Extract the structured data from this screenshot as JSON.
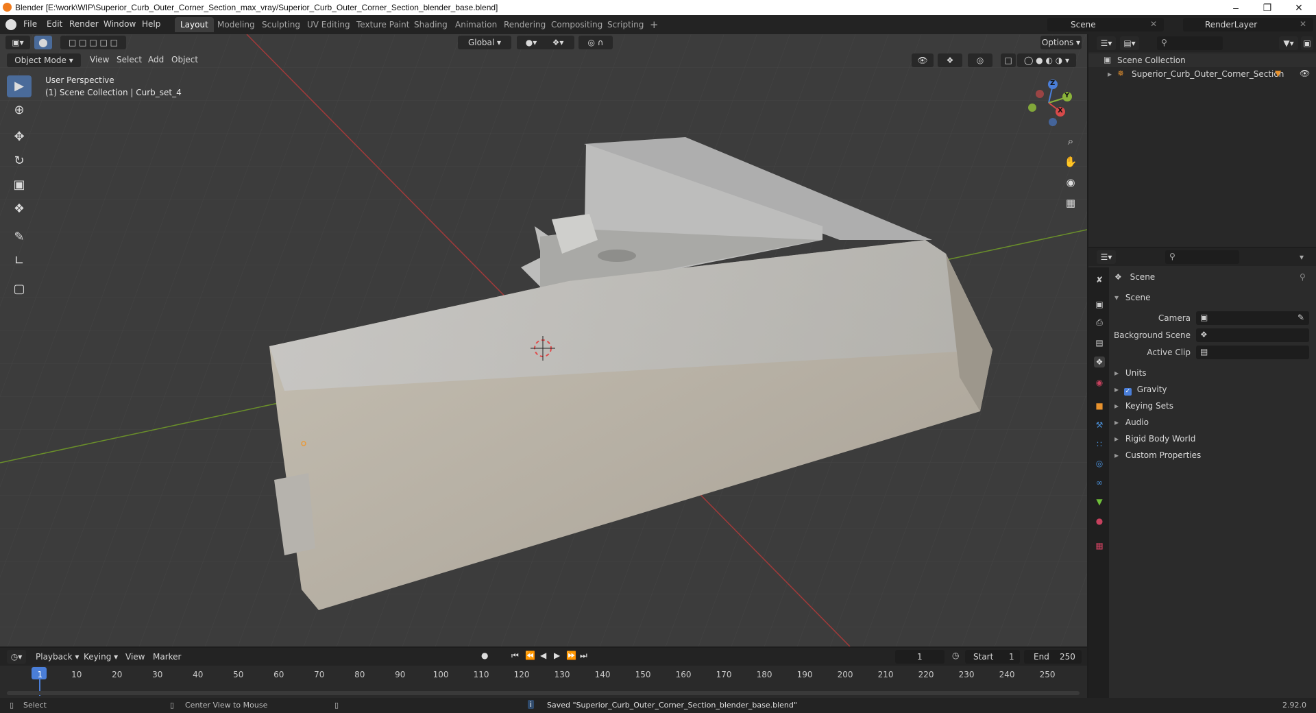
{
  "window": {
    "title": "Blender [E:\\work\\WIP\\Superior_Curb_Outer_Corner_Section_max_vray/Superior_Curb_Outer_Corner_Section_blender_base.blend]"
  },
  "menu": [
    "File",
    "Edit",
    "Render",
    "Window",
    "Help"
  ],
  "workspaces": [
    "Layout",
    "Modeling",
    "Sculpting",
    "UV Editing",
    "Texture Paint",
    "Shading",
    "Animation",
    "Rendering",
    "Compositing",
    "Scripting"
  ],
  "scene_field": "Scene",
  "renderlayer_field": "RenderLayer",
  "viewport": {
    "mode": "Object Mode",
    "menus": [
      "View",
      "Select",
      "Add",
      "Object"
    ],
    "transform": "Global",
    "options": "Options",
    "overlay_line1": "User Perspective",
    "overlay_line2": "(1) Scene Collection | Curb_set_4",
    "gizmo_axes": [
      "Z",
      "Y",
      "X"
    ]
  },
  "outliner": {
    "root": "Scene Collection",
    "items": [
      "Superior_Curb_Outer_Corner_Section"
    ]
  },
  "properties": {
    "context": "Scene",
    "panel": "Scene",
    "fields": {
      "camera": "Camera",
      "background": "Background Scene",
      "clip": "Active Clip"
    },
    "sections": [
      "Units",
      "Gravity",
      "Keying Sets",
      "Audio",
      "Rigid Body World",
      "Custom Properties"
    ]
  },
  "timeline": {
    "menus": [
      "Playback",
      "Keying",
      "View",
      "Marker"
    ],
    "current_frame": "1",
    "start_label": "Start",
    "start": "1",
    "end_label": "End",
    "end": "250",
    "ticks": [
      "1",
      "10",
      "20",
      "30",
      "40",
      "50",
      "60",
      "70",
      "80",
      "90",
      "100",
      "110",
      "120",
      "130",
      "140",
      "150",
      "160",
      "170",
      "180",
      "190",
      "200",
      "210",
      "220",
      "230",
      "240",
      "250"
    ]
  },
  "status": {
    "select": "Select",
    "center": "Center View to Mouse",
    "message": "Saved \"Superior_Curb_Outer_Corner_Section_blender_base.blend\"",
    "version": "2.92.0"
  }
}
